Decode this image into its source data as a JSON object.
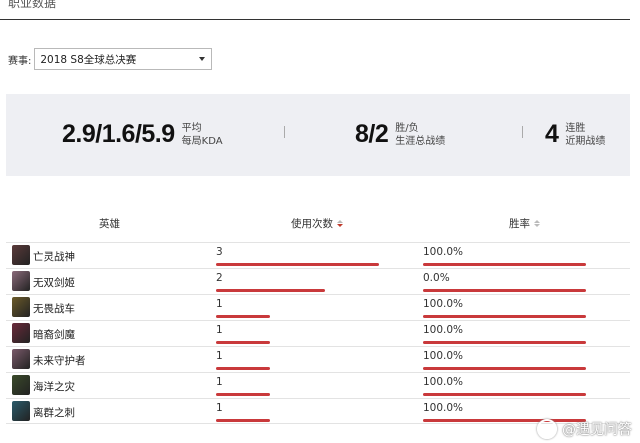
{
  "tab": {
    "title": "职业数据"
  },
  "filter": {
    "label": "赛事:",
    "selected": "2018 S8全球总决赛"
  },
  "stats": [
    {
      "value": "2.9/1.6/5.9",
      "line1": "平均",
      "line2": "每局KDA"
    },
    {
      "value": "8/2",
      "line1": "胜/负",
      "line2": "生涯总战绩"
    },
    {
      "value": "4",
      "line1": "连胜",
      "line2": "近期战绩"
    }
  ],
  "table": {
    "headers": {
      "hero": "英雄",
      "uses": "使用次数",
      "winrate": "胜率"
    },
    "max_uses": 3,
    "rows": [
      {
        "hero": "亡灵战神",
        "uses": 3,
        "uses_label": "3",
        "winrate": 100.0,
        "winrate_label": "100.0%",
        "avatar_color": "#5a3a3a"
      },
      {
        "hero": "无双剑姬",
        "uses": 2,
        "uses_label": "2",
        "winrate": 0.0,
        "winrate_label": "0.0%",
        "avatar_color": "#8a6a7a"
      },
      {
        "hero": "无畏战车",
        "uses": 1,
        "uses_label": "1",
        "winrate": 100.0,
        "winrate_label": "100.0%",
        "avatar_color": "#6b5a2a"
      },
      {
        "hero": "暗裔剑魔",
        "uses": 1,
        "uses_label": "1",
        "winrate": 100.0,
        "winrate_label": "100.0%",
        "avatar_color": "#6a2a3a"
      },
      {
        "hero": "未来守护者",
        "uses": 1,
        "uses_label": "1",
        "winrate": 100.0,
        "winrate_label": "100.0%",
        "avatar_color": "#7a5a6a"
      },
      {
        "hero": "海洋之灾",
        "uses": 1,
        "uses_label": "1",
        "winrate": 100.0,
        "winrate_label": "100.0%",
        "avatar_color": "#3a4a2a"
      },
      {
        "hero": "离群之刺",
        "uses": 1,
        "uses_label": "1",
        "winrate": 100.0,
        "winrate_label": "100.0%",
        "avatar_color": "#2a5a6a"
      }
    ]
  },
  "watermark": {
    "text": "@遇见问答"
  }
}
